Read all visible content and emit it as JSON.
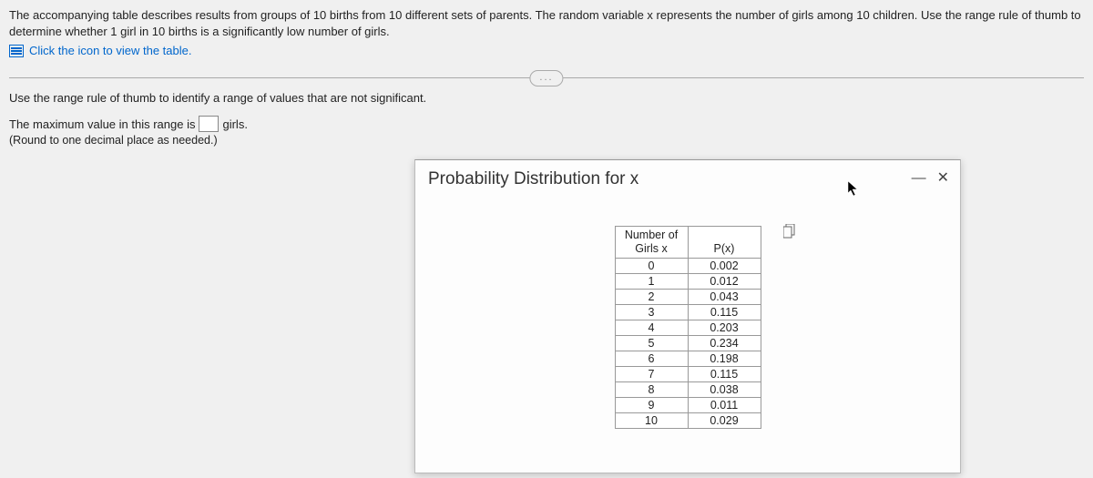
{
  "problem": {
    "text": "The accompanying table describes results from groups of 10 births from 10 different sets of parents. The random variable x represents the number of girls among 10 children. Use the range rule of thumb to determine whether 1 girl in 10 births is a significantly low number of girls.",
    "link_label": "Click the icon to view the table."
  },
  "divider": {
    "ellipsis": "..."
  },
  "question": {
    "instruction": "Use the range rule of thumb to identify a range of values that are not significant.",
    "line_pre": "The maximum value in this range is",
    "line_post": "girls.",
    "round_hint": "(Round to one decimal place as needed.)",
    "input_value": ""
  },
  "modal": {
    "title": "Probability Distribution for x",
    "col1_line1": "Number of",
    "col1_line2": "Girls x",
    "col2": "P(x)",
    "rows": [
      {
        "x": "0",
        "p": "0.002"
      },
      {
        "x": "1",
        "p": "0.012"
      },
      {
        "x": "2",
        "p": "0.043"
      },
      {
        "x": "3",
        "p": "0.115"
      },
      {
        "x": "4",
        "p": "0.203"
      },
      {
        "x": "5",
        "p": "0.234"
      },
      {
        "x": "6",
        "p": "0.198"
      },
      {
        "x": "7",
        "p": "0.115"
      },
      {
        "x": "8",
        "p": "0.038"
      },
      {
        "x": "9",
        "p": "0.011"
      },
      {
        "x": "10",
        "p": "0.029"
      }
    ],
    "minimize": "—",
    "close": "✕"
  }
}
